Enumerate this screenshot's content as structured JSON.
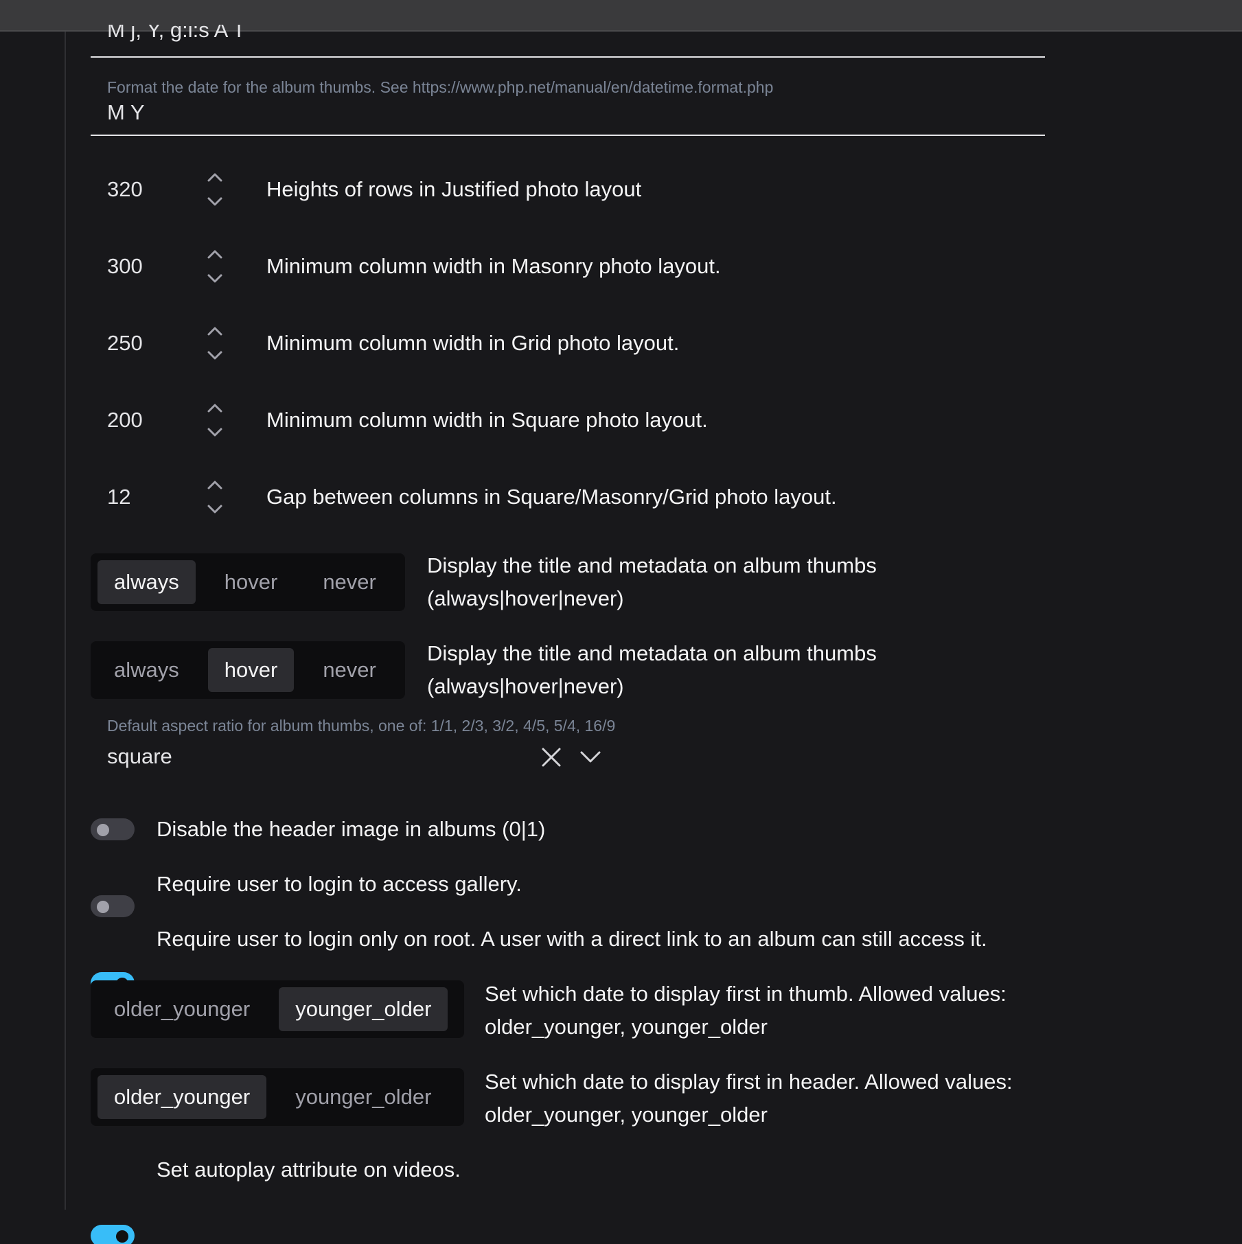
{
  "fields": {
    "date_format_top": {
      "value": "M j, Y, g:i:s A T"
    },
    "album_thumb_date": {
      "help": "Format the date for the album thumbs. See https://www.php.net/manual/en/datetime.format.php",
      "value": "M Y"
    }
  },
  "numbers": [
    {
      "value": "320",
      "label": "Heights of rows in Justified photo layout"
    },
    {
      "value": "300",
      "label": "Minimum column width in Masonry photo layout."
    },
    {
      "value": "250",
      "label": "Minimum column width in Grid photo layout."
    },
    {
      "value": "200",
      "label": "Minimum column width in Square photo layout."
    },
    {
      "value": "12",
      "label": "Gap between columns in Square/Masonry/Grid photo layout."
    }
  ],
  "segments": [
    {
      "options": [
        "always",
        "hover",
        "never"
      ],
      "selected": "always",
      "label_line1": "Display the title and metadata on album thumbs",
      "label_line2": "(always|hover|never)"
    },
    {
      "options": [
        "always",
        "hover",
        "never"
      ],
      "selected": "hover",
      "label_line1": "Display the title and metadata on album thumbs",
      "label_line2": "(always|hover|never)"
    }
  ],
  "aspect": {
    "help": "Default aspect ratio for album thumbs, one of: 1/1, 2/3, 3/2, 4/5, 5/4, 16/9",
    "value": "square",
    "clear_icon": "close-icon",
    "dropdown_icon": "chevron-down-icon"
  },
  "toggles": [
    {
      "label": "Disable the header image in albums (0|1)",
      "on": false
    },
    {
      "label": "Require user to login to access gallery.",
      "on": false
    },
    {
      "label": "Require user to login only on root. A user with a direct link to an album can still access it.",
      "on": true
    }
  ],
  "date_order": [
    {
      "options": [
        "older_younger",
        "younger_older"
      ],
      "selected": "younger_older",
      "label_line1": "Set which date to display first in thumb. Allowed values:",
      "label_line2": "older_younger, younger_older"
    },
    {
      "options": [
        "older_younger",
        "younger_older"
      ],
      "selected": "older_younger",
      "label_line1": "Set which date to display first in header. Allowed values:",
      "label_line2": "older_younger, younger_older"
    }
  ],
  "autoplay": {
    "label": "Set autoplay attribute on videos.",
    "on": true
  },
  "colors": {
    "background": "#18181b",
    "accent": "#38bdf8",
    "help": "#7b8596"
  }
}
